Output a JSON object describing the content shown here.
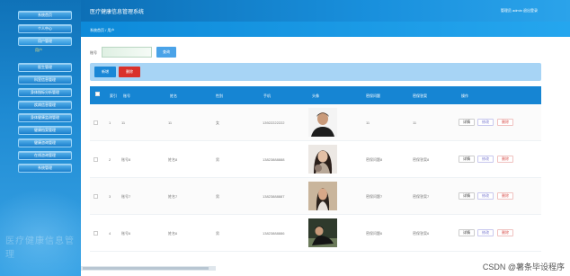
{
  "app": {
    "title": "医疗健康信息管理系统",
    "user_text": "管理员 admin  退出登录"
  },
  "sidebar": {
    "items": [
      {
        "label": "系统首页"
      },
      {
        "label": "个人中心"
      },
      {
        "label": "用户管理"
      },
      {
        "label": "医生管理"
      },
      {
        "label": "科室信息管理"
      },
      {
        "label": "身体指标分析管理"
      },
      {
        "label": "疾病信息管理"
      },
      {
        "label": "身体健康监测管理"
      },
      {
        "label": "健康档案管理"
      },
      {
        "label": "健康咨询管理"
      },
      {
        "label": "在线咨询管理"
      },
      {
        "label": "系统管理"
      }
    ],
    "sub_label": "用户",
    "watermark": "医疗健康信息管理"
  },
  "breadcrumb": {
    "text": "系统首页  /  用户"
  },
  "search": {
    "label": "账号",
    "value": "",
    "button": "查询"
  },
  "actions": {
    "add": "新增",
    "delete": "删除"
  },
  "table": {
    "headers": [
      "",
      "索引",
      "账号",
      "姓名",
      "性别",
      "手机",
      "头像",
      "密保问题",
      "密保答案",
      "操作"
    ],
    "rows": [
      {
        "index": "1",
        "account": "11",
        "name": "11",
        "gender": "女",
        "phone": "13922222222",
        "question": "11",
        "answer": "11"
      },
      {
        "index": "2",
        "account": "账号8",
        "name": "姓名8",
        "gender": "男",
        "phone": "13823888888",
        "question": "密保问题8",
        "answer": "密保答案8"
      },
      {
        "index": "3",
        "account": "账号7",
        "name": "姓名7",
        "gender": "男",
        "phone": "13823888887",
        "question": "密保问题7",
        "answer": "密保答案7"
      },
      {
        "index": "4",
        "account": "账号6",
        "name": "姓名6",
        "gender": "男",
        "phone": "13823888886",
        "question": "密保问题6",
        "answer": "密保答案6"
      }
    ],
    "ops": [
      "详情",
      "修改",
      "删除"
    ]
  },
  "footer": {
    "watermark": "CSDN @薯条毕设程序"
  }
}
